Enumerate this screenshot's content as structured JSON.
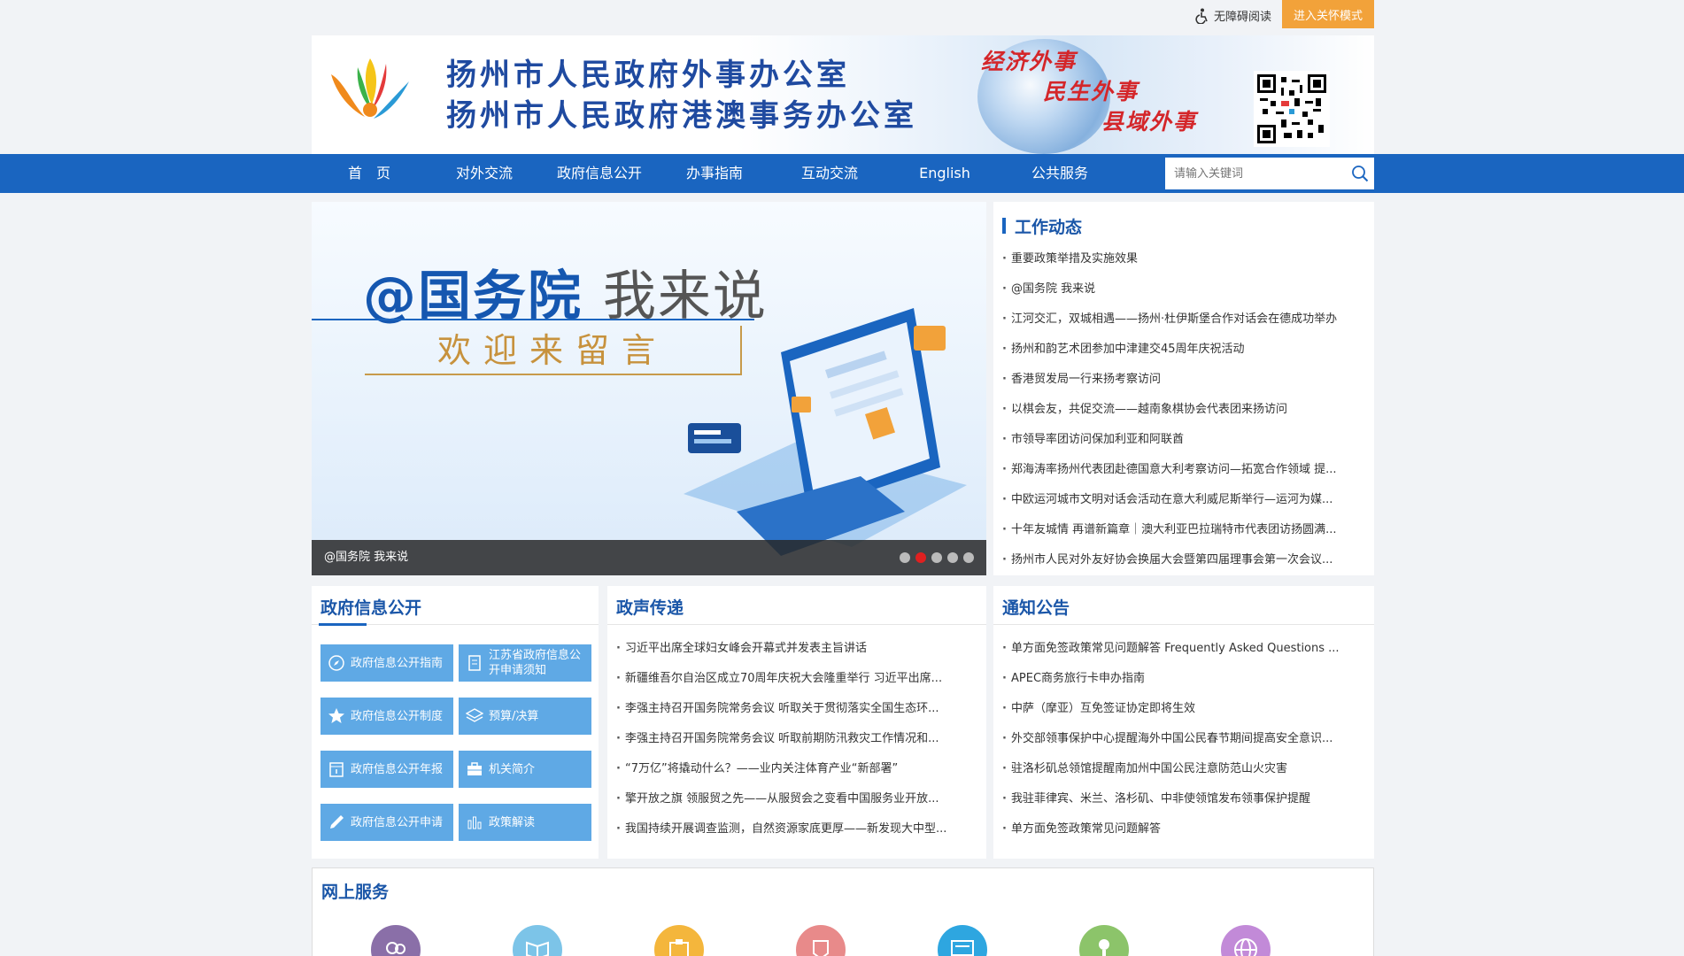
{
  "topbar": {
    "accessibility_label": "无障碍阅读",
    "care_mode_label": "进入关怀模式"
  },
  "header": {
    "title_line1": "扬州市人民政府外事办公室",
    "title_line2": "扬州市人民政府港澳事务办公室",
    "slogans": [
      "经济外事",
      "民生外事",
      "县域外事"
    ]
  },
  "nav": {
    "items": [
      "首　页",
      "对外交流",
      "政府信息公开",
      "办事指南",
      "互动交流",
      "English",
      "公共服务"
    ],
    "search_placeholder": "请输入关键词"
  },
  "carousel": {
    "headline_main": "@国务院",
    "headline_sub": "我来说",
    "tagline": "欢迎来留言",
    "caption": "@国务院 我来说",
    "slide_count": 5,
    "active_index": 1
  },
  "work_news": {
    "title": "工作动态",
    "items": [
      "重要政策举措及实施效果",
      "@国务院 我来说",
      "江河交汇，双城相遇——扬州·杜伊斯堡合作对话会在德成功举办",
      "扬州和韵艺术团参加中津建交45周年庆祝活动",
      "香港贸发局一行来扬考察访问",
      "以棋会友，共促交流——越南象棋协会代表团来扬访问",
      "市领导率团访问保加利亚和阿联酋",
      "郑海涛率扬州代表团赴德国意大利考察访问—拓宽合作领域 提...",
      "中欧运河城市文明对话会活动在意大利威尼斯举行—运河为媒...",
      "十年友城情 再谱新篇章｜澳大利亚巴拉瑞特市代表团访扬圆满...",
      "扬州市人民对外友好协会换届大会暨第四届理事会第一次会议..."
    ]
  },
  "gov_info": {
    "title": "政府信息公开",
    "buttons": [
      {
        "label": "政府信息公开指南",
        "icon": "compass-icon"
      },
      {
        "label": "江苏省政府信息公开申请须知",
        "icon": "document-icon"
      },
      {
        "label": "政府信息公开制度",
        "icon": "star-icon"
      },
      {
        "label": "预算/决算",
        "icon": "layers-icon"
      },
      {
        "label": "政府信息公开年报",
        "icon": "calendar-icon"
      },
      {
        "label": "机关简介",
        "icon": "briefcase-icon"
      },
      {
        "label": "政府信息公开申请",
        "icon": "pen-icon"
      },
      {
        "label": "政策解读",
        "icon": "bar-chart-icon"
      }
    ]
  },
  "gov_voice": {
    "title": "政声传递",
    "items": [
      "习近平出席全球妇女峰会开幕式并发表主旨讲话",
      "新疆维吾尔自治区成立70周年庆祝大会隆重举行 习近平出席...",
      "李强主持召开国务院常务会议 听取关于贯彻落实全国生态环...",
      "李强主持召开国务院常务会议 听取前期防汛救灾工作情况和...",
      "“7万亿”将撬动什么？——业内关注体育产业“新部署”",
      "擎开放之旗 领服贸之先——从服贸会之变看中国服务业开放...",
      "我国持续开展调查监测，自然资源家底更厚——新发现大中型..."
    ]
  },
  "notices": {
    "title": "通知公告",
    "items": [
      "单方面免签政策常见问题解答 Frequently Asked Questions ...",
      "APEC商务旅行卡申办指南",
      "中萨（摩亚）互免签证协定即将生效",
      "外交部领事保护中心提醒海外中国公民春节期间提高安全意识...",
      "驻洛杉矶总领馆提醒南加州中国公民注意防范山火灾害",
      "我驻菲律宾、米兰、洛杉矶、中非使领馆发布领事保护提醒",
      "单方面免签政策常见问题解答"
    ]
  },
  "online_services": {
    "title": "网上服务",
    "icons": [
      {
        "name": "people-icon",
        "color": "#8a6fa8"
      },
      {
        "name": "book-icon",
        "color": "#7cc4e8"
      },
      {
        "name": "clipboard-icon",
        "color": "#f4b63c"
      },
      {
        "name": "badge-icon",
        "color": "#e88a8a"
      },
      {
        "name": "screen-icon",
        "color": "#2ea6e0"
      },
      {
        "name": "person-icon",
        "color": "#8cc46a"
      },
      {
        "name": "globe-icon",
        "color": "#c28ad8"
      }
    ]
  }
}
